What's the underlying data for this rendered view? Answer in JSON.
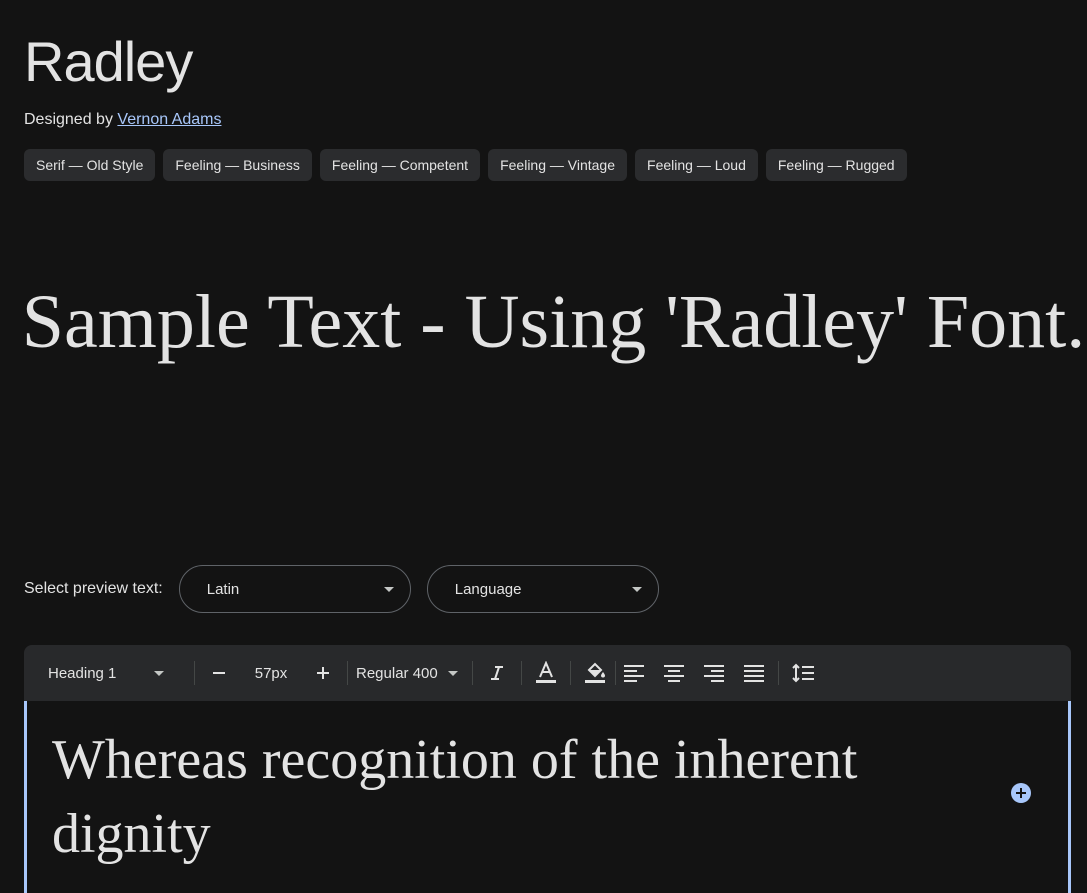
{
  "font": {
    "name": "Radley",
    "designed_by_prefix": "Designed by",
    "designer": "Vernon Adams"
  },
  "tags": [
    "Serif — Old Style",
    "Feeling — Business",
    "Feeling — Competent",
    "Feeling — Vintage",
    "Feeling — Loud",
    "Feeling — Rugged"
  ],
  "sample_text": "Sample Text - Using 'Radley' Font.",
  "preview": {
    "label": "Select preview text:",
    "script_value": "Latin",
    "language_value": "Language"
  },
  "toolbar": {
    "style_value": "Heading 1",
    "size_value": "57px",
    "weight_value": "Regular 400",
    "icons": [
      "minus-icon",
      "plus-icon",
      "italic-icon",
      "text-color-icon",
      "highlight-icon",
      "align-left-icon",
      "align-center-icon",
      "align-right-icon",
      "align-justify-icon",
      "line-height-icon"
    ]
  },
  "editor": {
    "text": "Whereas recognition of the inherent dignity"
  },
  "colors": {
    "background": "#131313",
    "accent": "#a8c7fa",
    "chip": "#2b2c2e",
    "toolbar": "#28292b"
  }
}
